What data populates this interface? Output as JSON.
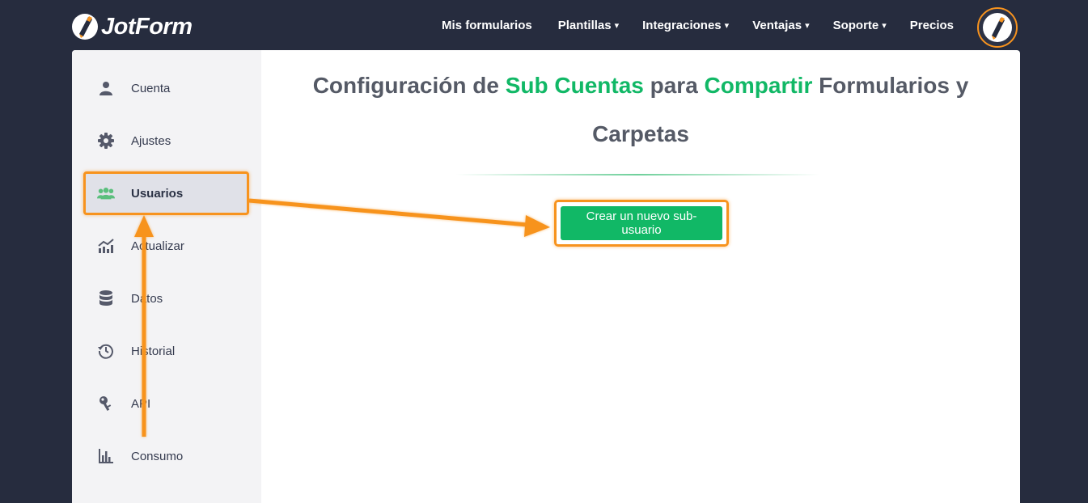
{
  "brand": {
    "name": "JotForm"
  },
  "nav": {
    "items": [
      {
        "label": "Mis formularios",
        "has_caret": false
      },
      {
        "label": "Plantillas",
        "has_caret": true
      },
      {
        "label": "Integraciones",
        "has_caret": true
      },
      {
        "label": "Ventajas",
        "has_caret": true
      },
      {
        "label": "Soporte",
        "has_caret": true
      },
      {
        "label": "Precios",
        "has_caret": false
      }
    ],
    "caret": "▾"
  },
  "sidebar": {
    "items": [
      {
        "label": "Cuenta",
        "icon": "user-icon"
      },
      {
        "label": "Ajustes",
        "icon": "gear-icon"
      },
      {
        "label": "Usuarios",
        "icon": "users-icon",
        "active": true
      },
      {
        "label": "Actualizar",
        "icon": "upgrade-chart-icon"
      },
      {
        "label": "Datos",
        "icon": "database-icon"
      },
      {
        "label": "Historial",
        "icon": "history-icon"
      },
      {
        "label": "API",
        "icon": "key-icon"
      },
      {
        "label": "Consumo",
        "icon": "bar-chart-icon"
      }
    ]
  },
  "main": {
    "title_part1": "Configuración de ",
    "title_hl1": "Sub Cuentas",
    "title_part2": " para ",
    "title_hl2": "Compartir",
    "title_part3": " Formularios y Carpetas",
    "create_button_label": "Crear un nuevo sub-usuario"
  },
  "colors": {
    "background": "#262c3e",
    "accent_green": "#11b866",
    "highlight_orange": "#f7931e",
    "sidebar_bg": "#f3f3f5",
    "active_item_bg": "#e0e1e8"
  }
}
